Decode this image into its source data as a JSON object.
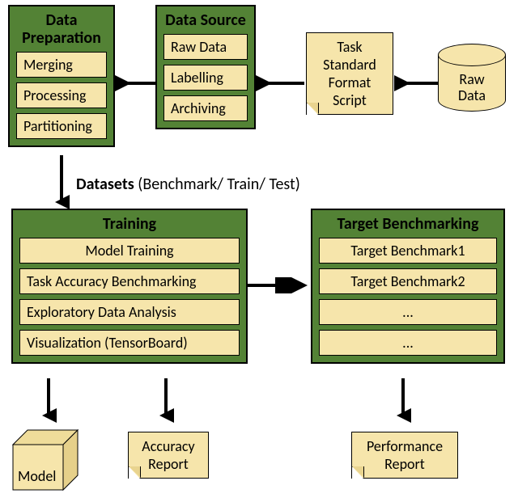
{
  "dataPrep": {
    "title": "Data Preparation",
    "items": [
      "Merging",
      "Processing",
      "Partitioning"
    ]
  },
  "dataSource": {
    "title": "Data Source",
    "items": [
      "Raw Data",
      "Labelling",
      "Archiving"
    ]
  },
  "taskScript": {
    "lines": [
      "Task",
      "Standard",
      "Format",
      "Script"
    ]
  },
  "rawData": {
    "line1": "Raw",
    "line2": "Data"
  },
  "datasetsLabel": {
    "bold": "Datasets",
    "rest": " (Benchmark/ Train/ Test)"
  },
  "training": {
    "title": "Training",
    "items": [
      "Model Training",
      "Task Accuracy Benchmarking",
      "Exploratory Data Analysis",
      "Visualization (TensorBoard)"
    ]
  },
  "targetBench": {
    "title": "Target Benchmarking",
    "items": [
      "Target Benchmark1",
      "Target Benchmark2",
      "...",
      "..."
    ]
  },
  "model": {
    "label": "Model"
  },
  "accuracyReport": {
    "line1": "Accuracy",
    "line2": "Report"
  },
  "perfReport": {
    "line1": "Performance",
    "line2": "Report"
  }
}
